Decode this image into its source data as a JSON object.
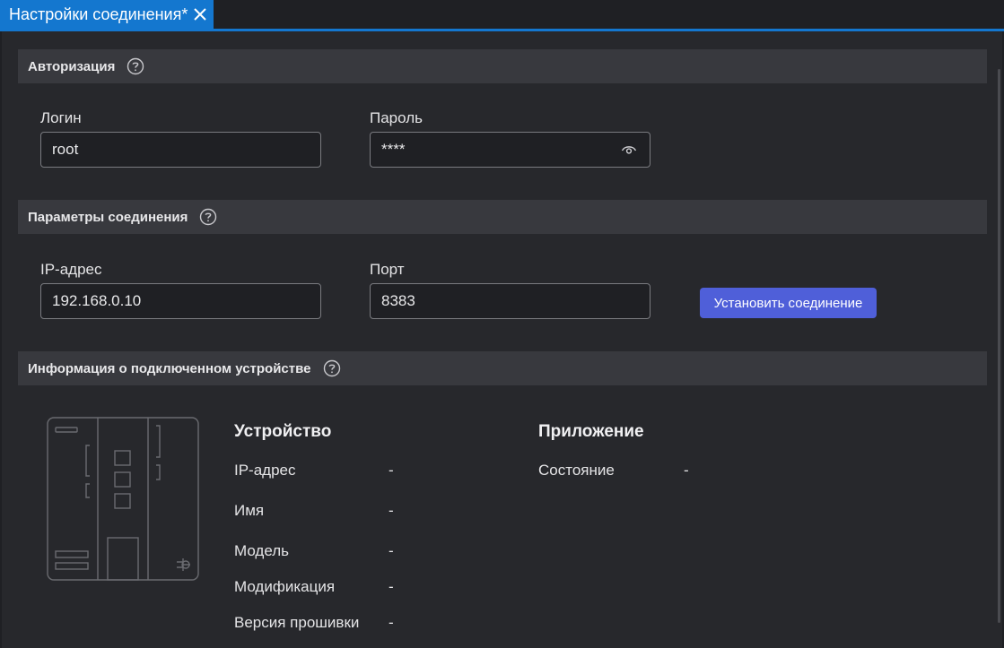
{
  "tab": {
    "title": "Настройки соединения*"
  },
  "auth": {
    "header": "Авторизация",
    "login_label": "Логин",
    "login_value": "root",
    "password_label": "Пароль",
    "password_value": "****"
  },
  "connection": {
    "header": "Параметры соединения",
    "ip_label": "IP-адрес",
    "ip_value": "192.168.0.10",
    "port_label": "Порт",
    "port_value": "8383",
    "connect_button": "Установить соединение"
  },
  "device_info": {
    "header": "Информация о подключенном устройстве",
    "device_title": "Устройство",
    "app_title": "Приложение",
    "device_rows": [
      {
        "label": "IP-адрес",
        "value": "-"
      },
      {
        "label": "Имя",
        "value": "-"
      },
      {
        "label": "Модель",
        "value": "-"
      },
      {
        "label": "Модификация",
        "value": "-"
      },
      {
        "label": "Версия прошивки",
        "value": "-"
      }
    ],
    "app_rows": [
      {
        "label": "Состояние",
        "value": "-"
      }
    ]
  },
  "colors": {
    "accent": "#1477cf",
    "button": "#4f5fd9",
    "section_bg": "#38393e",
    "panel_bg": "#27282c"
  },
  "icons": {
    "tab_close": "close-icon",
    "help": "help-circle-icon",
    "password_toggle": "eye-icon",
    "device": "controller-device-icon"
  }
}
